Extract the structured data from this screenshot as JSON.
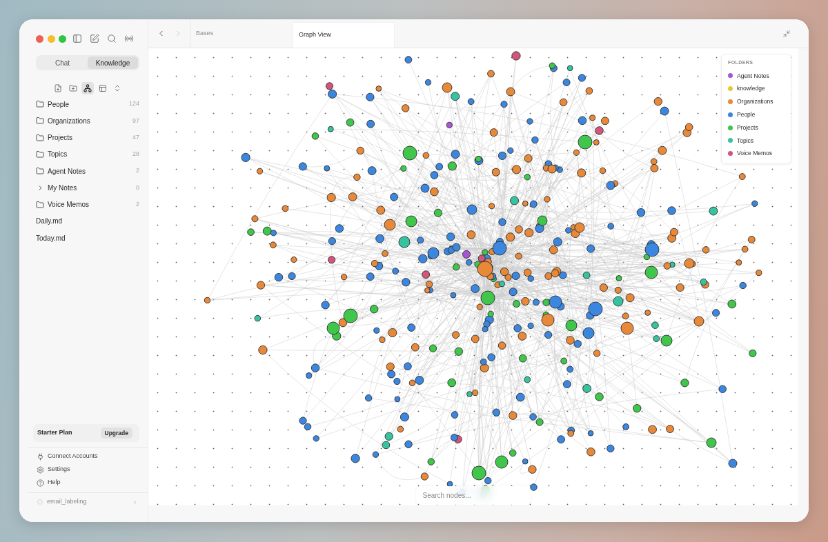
{
  "sidebar": {
    "mode_tabs": [
      {
        "label": "Chat",
        "selected": false
      },
      {
        "label": "Knowledge",
        "selected": true
      }
    ],
    "view_tools": [
      {
        "kind": "new_file",
        "selected": false
      },
      {
        "kind": "new_folder",
        "selected": false
      },
      {
        "kind": "graph",
        "selected": true
      },
      {
        "kind": "table",
        "selected": false
      },
      {
        "kind": "sort",
        "selected": false
      }
    ],
    "items": [
      {
        "kind": "folder",
        "label": "People",
        "count": "124"
      },
      {
        "kind": "folder",
        "label": "Organizations",
        "count": "97"
      },
      {
        "kind": "folder",
        "label": "Projects",
        "count": "47"
      },
      {
        "kind": "folder",
        "label": "Topics",
        "count": "28"
      },
      {
        "kind": "folder",
        "label": "Agent Notes",
        "count": "2"
      },
      {
        "kind": "group",
        "label": "My Notes",
        "count": "0",
        "expanded": false
      },
      {
        "kind": "folder",
        "label": "Voice Memos",
        "count": "2"
      },
      {
        "kind": "file",
        "label": "Daily.md"
      },
      {
        "kind": "file",
        "label": "Today.md"
      }
    ],
    "plan": {
      "label": "Starter Plan",
      "action": "Upgrade"
    },
    "links": [
      {
        "kind": "connect",
        "label": "Connect Accounts"
      },
      {
        "kind": "settings",
        "label": "Settings"
      },
      {
        "kind": "help",
        "label": "Help"
      }
    ],
    "workspace": {
      "label": "email_labeling"
    }
  },
  "navigation": {
    "back": {
      "disabled": false
    },
    "forward": {
      "disabled": true
    }
  },
  "tabs": [
    {
      "label": "Bases",
      "selected": false
    },
    {
      "label": "Graph View",
      "selected": true
    }
  ],
  "graph": {
    "legend": {
      "title": "FOLDERS",
      "items": [
        {
          "label": "Agent Notes",
          "color": "#a855d8"
        },
        {
          "label": "knowledge",
          "color": "#e6c93a"
        },
        {
          "label": "Organizations",
          "color": "#e8893a"
        },
        {
          "label": "People",
          "color": "#3b87e0"
        },
        {
          "label": "Projects",
          "color": "#3fc64b"
        },
        {
          "label": "Topics",
          "color": "#36c4a0"
        },
        {
          "label": "Voice Memos",
          "color": "#d2557c"
        }
      ]
    },
    "search": {
      "placeholder": "Search nodes..."
    }
  }
}
